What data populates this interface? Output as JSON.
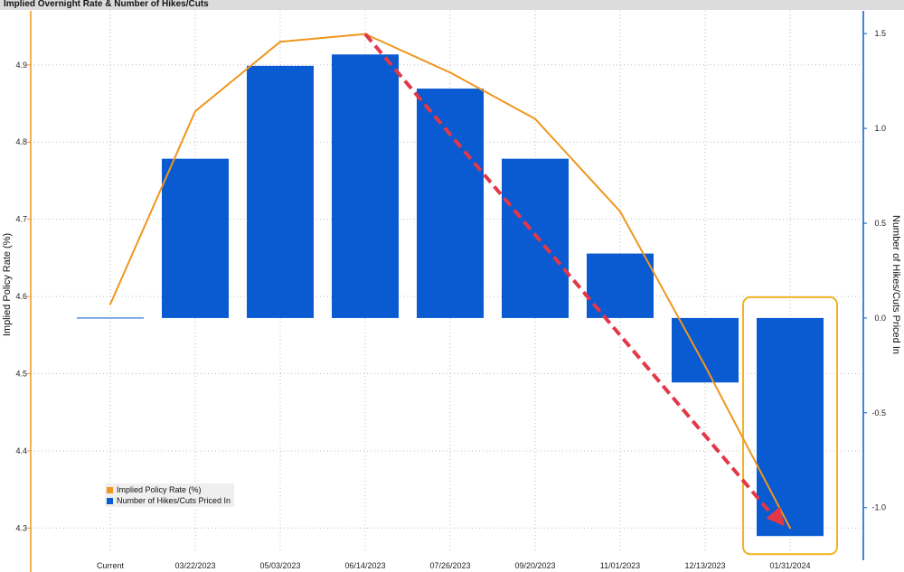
{
  "header": {
    "title": "Implied Overnight Rate & Number of Hikes/Cuts"
  },
  "colors": {
    "line": "#f0961e",
    "bar": "#0a5ad2",
    "arrow": "#e23848",
    "highlight": "#f0b423",
    "grid": "#bdbdbd",
    "axis_left": "#f0961e",
    "axis_right": "#0a5ad2"
  },
  "chart_data": {
    "type": "bar",
    "categories": [
      "Current",
      "03/22/2023",
      "05/03/2023",
      "06/14/2023",
      "07/26/2023",
      "09/20/2023",
      "11/01/2023",
      "12/13/2023",
      "01/31/2024"
    ],
    "series": [
      {
        "name": "Implied Policy Rate (%)",
        "type": "line",
        "axis": "left",
        "values": [
          4.59,
          4.84,
          4.93,
          4.94,
          4.89,
          4.83,
          4.71,
          4.51,
          4.3
        ]
      },
      {
        "name": "Number of Hikes/Cuts Priced In",
        "type": "bar",
        "axis": "right",
        "values": [
          0.0,
          0.84,
          1.33,
          1.39,
          1.21,
          0.84,
          0.34,
          -0.34,
          -1.15
        ]
      }
    ],
    "ylabel": "Implied Policy Rate (%)",
    "y2label": "Number of Hikes/Cuts Priced In",
    "ylim": [
      4.27,
      4.97
    ],
    "y2lim": [
      -1.23,
      1.62
    ],
    "yticks": [
      "4.9",
      "4.8",
      "4.7",
      "4.6",
      "4.5",
      "4.4",
      "4.3"
    ],
    "y2ticks": [
      "1.5",
      "1.0",
      "0.5",
      "0.0",
      "-0.5",
      "-1.0"
    ],
    "grid": true,
    "legend_position": "bottom-left",
    "annotations": [
      {
        "type": "dashed-arrow",
        "from_category": "06/14/2023",
        "from_value": 4.94,
        "to_category": "01/31/2024",
        "to_value": 4.3
      },
      {
        "type": "highlight-box",
        "category": "01/31/2024"
      }
    ]
  },
  "legend": {
    "items": [
      {
        "label": "Implied Policy Rate (%)",
        "color": "#f0961e"
      },
      {
        "label": "Number of Hikes/Cuts Priced In",
        "color": "#0a5ad2"
      }
    ]
  }
}
